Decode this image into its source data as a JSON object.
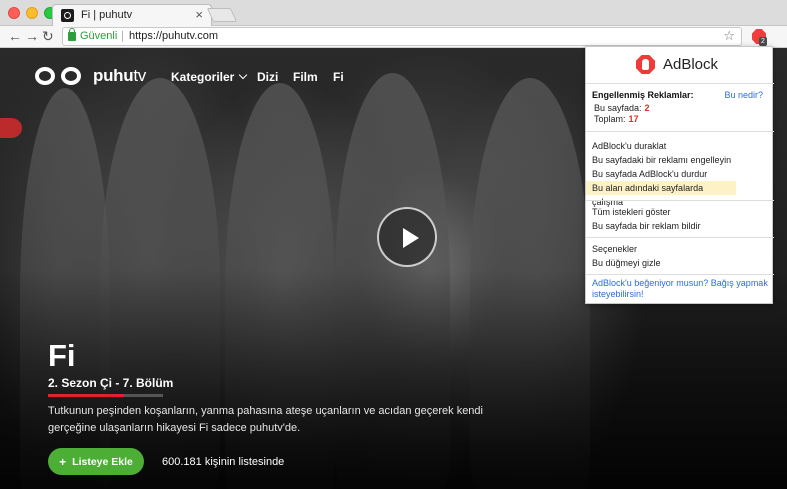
{
  "browser": {
    "tab_title": "Fi | puhutv",
    "tab_close": "×",
    "nav_back": "←",
    "nav_forward": "→",
    "nav_reload": "↻",
    "secure_label": "Güvenli",
    "url_separator": "|",
    "url": "https://puhutv.com",
    "bookmark_icon": "☆",
    "adblock_badge": "2",
    "menu_icon": "⋮"
  },
  "site": {
    "logo_text": "puhu",
    "logo_text_tv": "tv",
    "nav": {
      "categories": "Kategoriler",
      "series": "Dizi",
      "film": "Film",
      "fi": "Fi"
    },
    "hero": {
      "title": "Fi",
      "episode": "2. Sezon Çi - 7. Bölüm",
      "episode_progress": 0.66,
      "synopsis": "Tutkunun peşinden koşanların, yanma pahasına ateşe uçanların ve acıdan geçerek kendi gerçeğine ulaşanların hikayesi Fi sadece puhutv'de.",
      "add_button_icon": "+",
      "add_button": "Listeye Ekle",
      "list_count": "600.181 kişinin listesinde"
    }
  },
  "adblock": {
    "name": "AdBlock",
    "blocked_title": "Engellenmiş Reklamlar:",
    "what_is": "Bu nedir?",
    "this_page_label": "Bu sayfada:",
    "this_page_count": "2",
    "total_label": "Toplam:",
    "total_count": "17",
    "menu": [
      "AdBlock'u duraklat",
      "Bu sayfadaki bir reklamı engelleyin",
      "Bu sayfada AdBlock'u durdur",
      "Bu alan adındaki sayfalarda çalışma",
      "Tüm istekleri göster",
      "Bu sayfada bir reklam bildir",
      "Seçenekler",
      "Bu düğmeyi gizle"
    ],
    "footer": "AdBlock'u beğeniyor musun? Bağış yapmak isteyebilirsin!"
  }
}
